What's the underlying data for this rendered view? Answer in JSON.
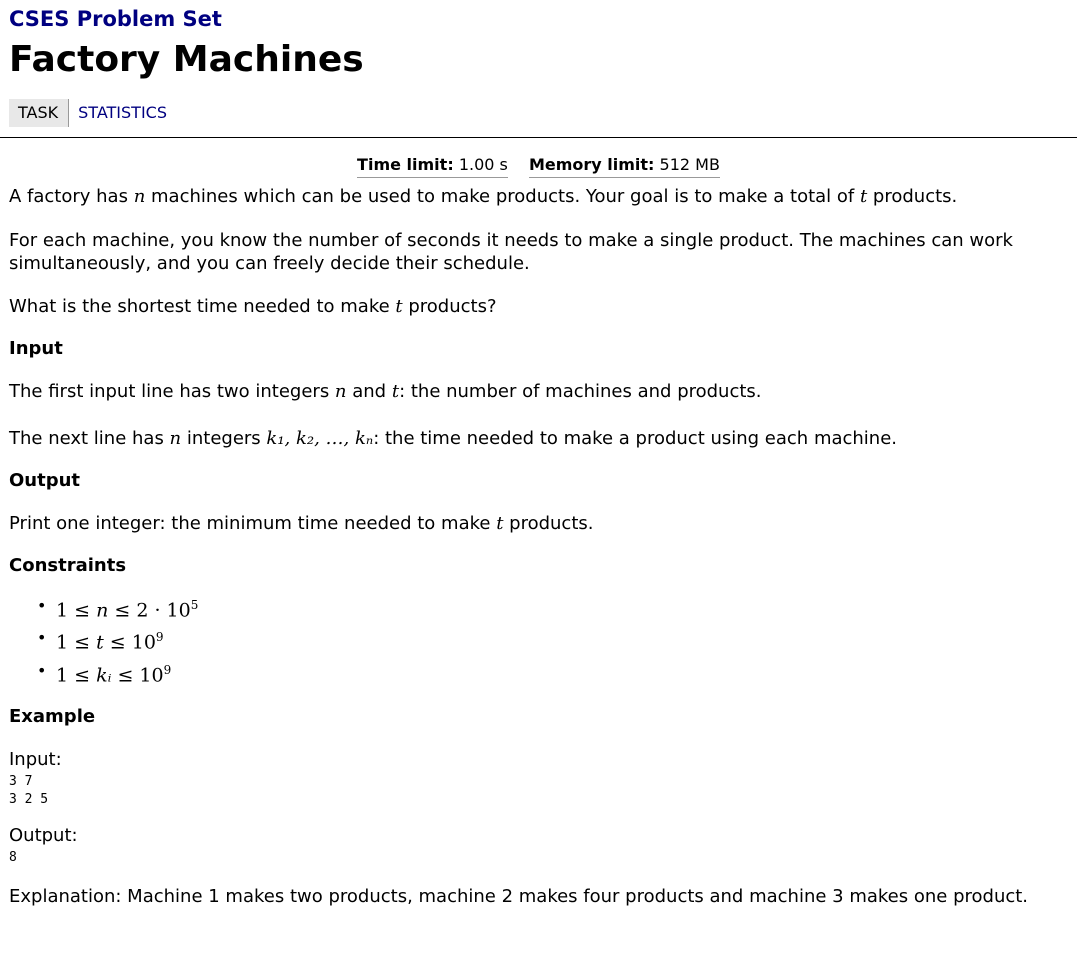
{
  "header": {
    "site_title": "CSES Problem Set",
    "page_title": "Factory Machines",
    "tabs": [
      {
        "label": "TASK",
        "active": true
      },
      {
        "label": "STATISTICS",
        "active": false
      }
    ]
  },
  "limits": {
    "time_label": "Time limit:",
    "time_value": "1.00 s",
    "memory_label": "Memory limit:",
    "memory_value": "512 MB"
  },
  "statement": {
    "p1_a": "A factory has ",
    "p1_var1": "n",
    "p1_b": " machines which can be used to make products. Your goal is to make a total of ",
    "p1_var2": "t",
    "p1_c": " products.",
    "p2": "For each machine, you know the number of seconds it needs to make a single product. The machines can work simultaneously, and you can freely decide their schedule.",
    "p3_a": "What is the shortest time needed to make ",
    "p3_var": "t",
    "p3_b": " products?"
  },
  "input_section": {
    "heading": "Input",
    "p1_a": "The first input line has two integers ",
    "p1_var1": "n",
    "p1_b": " and ",
    "p1_var2": "t",
    "p1_c": ": the number of machines and products.",
    "p2_a": "The next line has ",
    "p2_var": "n",
    "p2_b": " integers ",
    "p2_math": "k₁, k₂, …, kₙ",
    "p2_c": ": the time needed to make a product using each machine."
  },
  "output_section": {
    "heading": "Output",
    "p_a": "Print one integer: the minimum time needed to make ",
    "p_var": "t",
    "p_b": " products."
  },
  "constraints": {
    "heading": "Constraints",
    "items": [
      {
        "lhs": "1 ≤ ",
        "var": "n",
        "rhs": " ≤ 2 · 10",
        "exp": "5"
      },
      {
        "lhs": "1 ≤ ",
        "var": "t",
        "rhs": " ≤ 10",
        "exp": "9"
      },
      {
        "lhs": "1 ≤ ",
        "var": "kᵢ",
        "rhs": " ≤ 10",
        "exp": "9"
      }
    ]
  },
  "example": {
    "heading": "Example",
    "input_label": "Input:",
    "input_text": "3 7\n3 2 5",
    "output_label": "Output:",
    "output_text": "8",
    "explanation": "Explanation: Machine 1 makes two products, machine 2 makes four products and machine 3 makes one product."
  }
}
